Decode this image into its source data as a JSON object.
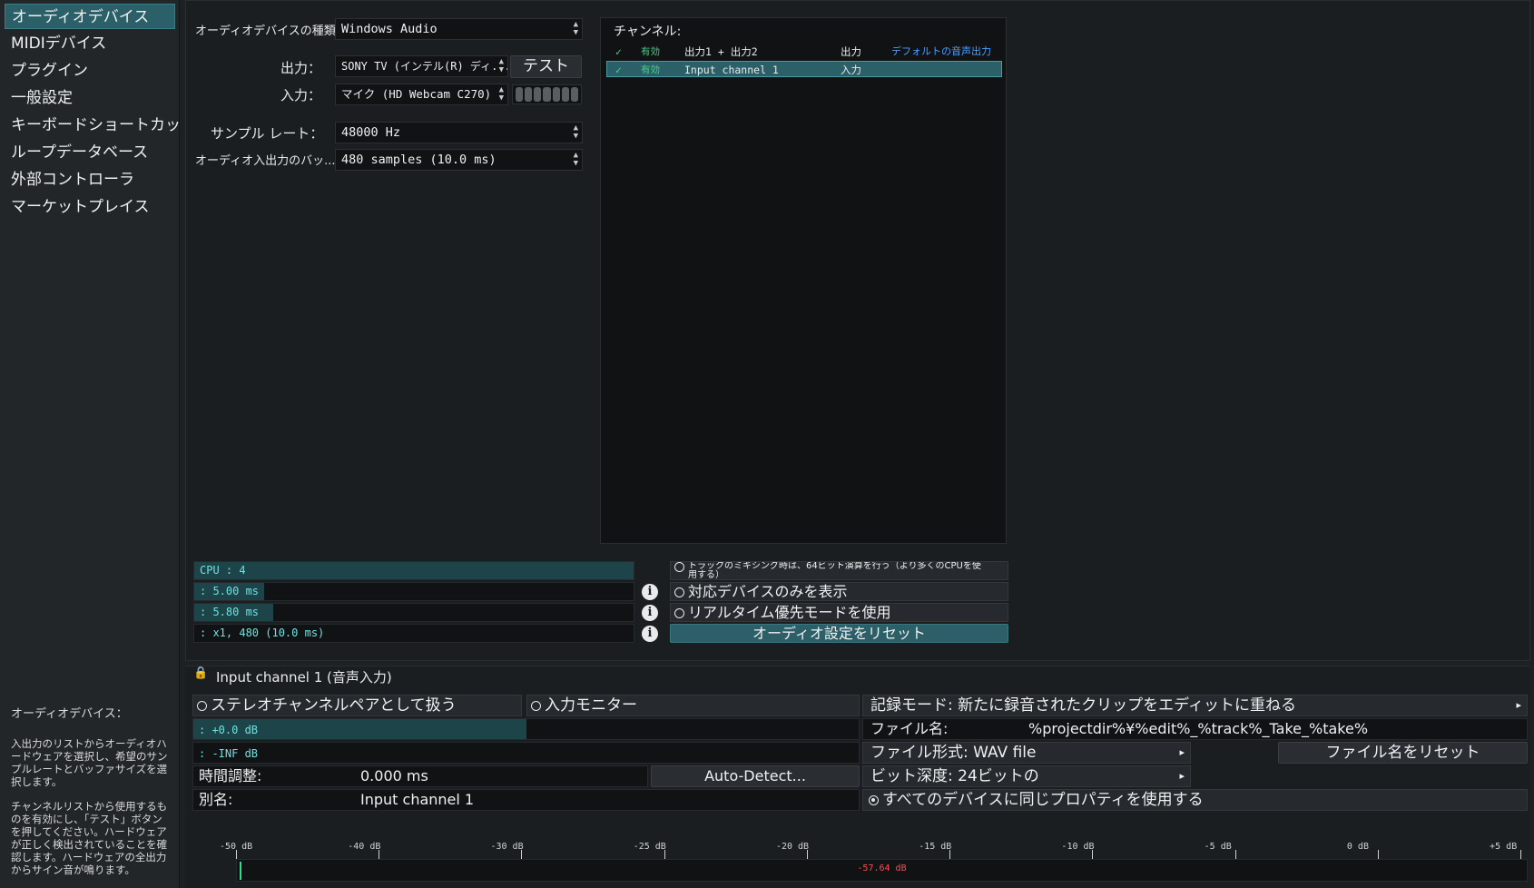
{
  "sidebar": {
    "items": [
      {
        "label": "オーディオデバイス",
        "active": true
      },
      {
        "label": "MIDIデバイス"
      },
      {
        "label": "プラグイン"
      },
      {
        "label": "一般設定"
      },
      {
        "label": "キーボードショートカット"
      },
      {
        "label": "ループデータベース"
      },
      {
        "label": "外部コントローラ"
      },
      {
        "label": "マーケットプレイス"
      }
    ],
    "help_title": "オーディオデバイス：",
    "help_p1": "入出力のリストからオーディオハードウェアを選択し、希望のサンプルレートとバッファサイズを選択します。",
    "help_p2": "チャンネルリストから使用するものを有効にし、「テスト」ボタンを押してください。ハードウェアが正しく検出されていることを確認します。ハードウェアの全出力からサイン音が鳴ります。"
  },
  "settings": {
    "device_type_label": "オーディオデバイスの種類：",
    "device_type_value": "Windows Audio",
    "output_label": "出力：",
    "output_value": "SONY TV (インテル(R) ディ...",
    "test_button": "テスト",
    "input_label": "入力：",
    "input_value": "マイク (HD Webcam C270)",
    "sample_rate_label": "サンプル レート：",
    "sample_rate_value": "48000 Hz",
    "buffer_label": "オーディオ入出力のバッ...",
    "buffer_value": "480 samples (10.0 ms)"
  },
  "channels": {
    "title": "チャンネル:",
    "rows": [
      {
        "check": "✓",
        "enabled": "有効",
        "name": "出力1 + 出力2",
        "type": "出力",
        "note": "デフォルトの音声出力"
      },
      {
        "check": "✓",
        "enabled": "有効",
        "name": "Input channel 1",
        "type": "入力",
        "note": ""
      }
    ]
  },
  "stats": {
    "cpu": "CPU : 4",
    "lat1": ": 5.00 ms",
    "lat2": ": 5.80 ms",
    "buffer": ": x1, 480  (10.0 ms)",
    "info_glyph": "i"
  },
  "options": {
    "mix64": "トラックのミキシング時は、64ビット演算を行う（より多くのCPUを使用する）",
    "supported_only": "対応デバイスのみを表示",
    "realtime": "リアルタイム優先モードを使用",
    "reset": "オーディオ設定をリセット"
  },
  "input_panel": {
    "lock_glyph": "🔒",
    "title": "Input channel 1 (音声入力)",
    "stereo_pair": "ステレオチャンネルペアとして扱う",
    "monitor": "入力モニター",
    "gain": ": +0.0 dB",
    "level": ": -INF dB",
    "time_adjust_label": "時間調整:",
    "time_adjust_value": "0.000 ms",
    "auto_detect": "Auto-Detect...",
    "alias_label": "別名:",
    "alias_value": "Input channel 1",
    "record_mode": "記録モード: 新たに録音されたクリップをエディットに重ねる",
    "filename_label": "ファイル名:",
    "filename_value": "%projectdir%¥%edit%_%track%_Take_%take%",
    "file_format": "ファイル形式: WAV file",
    "reset_filename": "ファイル名をリセット",
    "bit_depth": "ビット深度: 24ビットの",
    "same_props": "すべてのデバイスに同じプロパティを使用する",
    "arrow_glyph": "▸"
  },
  "meter": {
    "ticks": [
      "-50 dB",
      "-40 dB",
      "-30 dB",
      "-25 dB",
      "-20 dB",
      "-15 dB",
      "-10 dB",
      "-5 dB",
      "0 dB",
      "+5 dB"
    ],
    "reading": "-57.64 dB",
    "reading_color": "#ff4d4d"
  },
  "colors": {
    "accent": "#2c6068",
    "check": "#2fe08a",
    "link_blue": "#4aa0ff",
    "meter_text": "#6fe0e0"
  }
}
